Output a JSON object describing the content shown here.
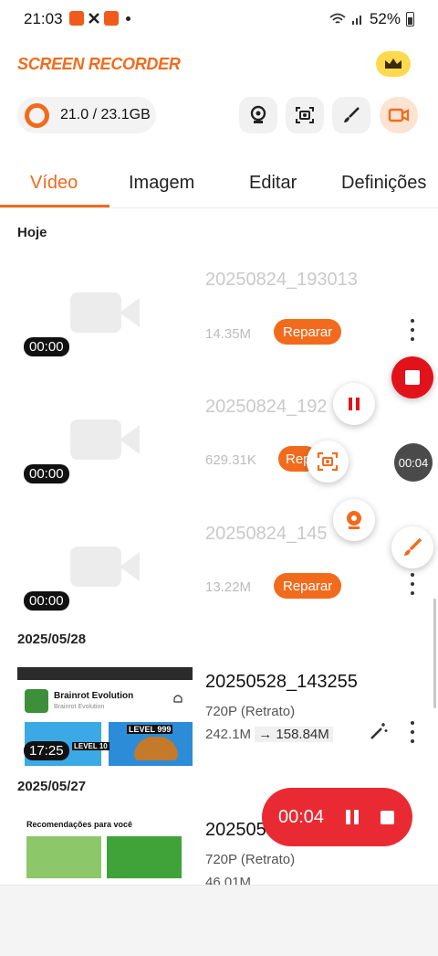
{
  "status_bar": {
    "time": "21:03",
    "battery": "52%"
  },
  "app": {
    "brand": "SCREEN RECORDER",
    "accent_color": "#f26b1d",
    "storage": "21.0 / 23.1GB"
  },
  "toolbar": {
    "icons": [
      "webcam-icon",
      "screenshot-icon",
      "brush-icon",
      "video-camera-icon"
    ]
  },
  "tabs": [
    {
      "label": "Vídeo",
      "active": true
    },
    {
      "label": "Imagem",
      "active": false
    },
    {
      "label": "Editar",
      "active": false
    },
    {
      "label": "Definições",
      "active": false
    }
  ],
  "sections": {
    "today": "Hoje",
    "date1": "2025/05/28",
    "date2": "2025/05/27"
  },
  "videos": [
    {
      "name": "20250824_193013",
      "size": "14.35M",
      "duration": "00:00",
      "action": "Reparar"
    },
    {
      "name": "20250824_192",
      "size": "629.31K",
      "duration": "00:00",
      "action": "Rep"
    },
    {
      "name": "20250824_145",
      "size": "13.22M",
      "duration": "00:00",
      "action": "Reparar"
    },
    {
      "name": "20250528_143255",
      "resolution": "720P (Retrato)",
      "size": "242.1M",
      "compressed": "158.84M",
      "duration": "17:25",
      "thumb_title": "Brainrot Evolution",
      "thumb_sub": "Brainrot Evolution",
      "thumb_badge1": "LEVEL 999",
      "thumb_badge2": "LEVEL 10"
    },
    {
      "name": "202505",
      "resolution": "720P (Retrato)",
      "size": "46.01M",
      "thumb_title": "Recomendações para você"
    }
  ],
  "floating": {
    "close_timer": "00:04"
  },
  "recording": {
    "time": "00:04",
    "color": "#ea2a32"
  }
}
